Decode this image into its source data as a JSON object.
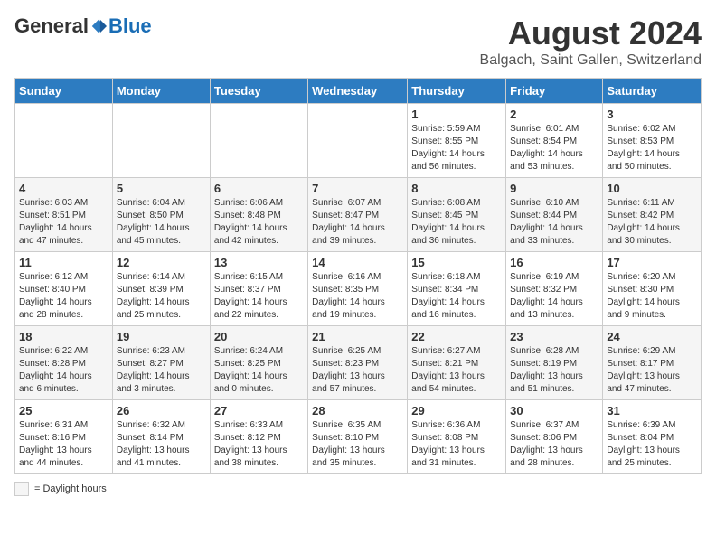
{
  "logo": {
    "general": "General",
    "blue": "Blue"
  },
  "title": "August 2024",
  "location": "Balgach, Saint Gallen, Switzerland",
  "days_of_week": [
    "Sunday",
    "Monday",
    "Tuesday",
    "Wednesday",
    "Thursday",
    "Friday",
    "Saturday"
  ],
  "weeks": [
    [
      {
        "day": "",
        "info": ""
      },
      {
        "day": "",
        "info": ""
      },
      {
        "day": "",
        "info": ""
      },
      {
        "day": "",
        "info": ""
      },
      {
        "day": "1",
        "info": "Sunrise: 5:59 AM\nSunset: 8:55 PM\nDaylight: 14 hours\nand 56 minutes."
      },
      {
        "day": "2",
        "info": "Sunrise: 6:01 AM\nSunset: 8:54 PM\nDaylight: 14 hours\nand 53 minutes."
      },
      {
        "day": "3",
        "info": "Sunrise: 6:02 AM\nSunset: 8:53 PM\nDaylight: 14 hours\nand 50 minutes."
      }
    ],
    [
      {
        "day": "4",
        "info": "Sunrise: 6:03 AM\nSunset: 8:51 PM\nDaylight: 14 hours\nand 47 minutes."
      },
      {
        "day": "5",
        "info": "Sunrise: 6:04 AM\nSunset: 8:50 PM\nDaylight: 14 hours\nand 45 minutes."
      },
      {
        "day": "6",
        "info": "Sunrise: 6:06 AM\nSunset: 8:48 PM\nDaylight: 14 hours\nand 42 minutes."
      },
      {
        "day": "7",
        "info": "Sunrise: 6:07 AM\nSunset: 8:47 PM\nDaylight: 14 hours\nand 39 minutes."
      },
      {
        "day": "8",
        "info": "Sunrise: 6:08 AM\nSunset: 8:45 PM\nDaylight: 14 hours\nand 36 minutes."
      },
      {
        "day": "9",
        "info": "Sunrise: 6:10 AM\nSunset: 8:44 PM\nDaylight: 14 hours\nand 33 minutes."
      },
      {
        "day": "10",
        "info": "Sunrise: 6:11 AM\nSunset: 8:42 PM\nDaylight: 14 hours\nand 30 minutes."
      }
    ],
    [
      {
        "day": "11",
        "info": "Sunrise: 6:12 AM\nSunset: 8:40 PM\nDaylight: 14 hours\nand 28 minutes."
      },
      {
        "day": "12",
        "info": "Sunrise: 6:14 AM\nSunset: 8:39 PM\nDaylight: 14 hours\nand 25 minutes."
      },
      {
        "day": "13",
        "info": "Sunrise: 6:15 AM\nSunset: 8:37 PM\nDaylight: 14 hours\nand 22 minutes."
      },
      {
        "day": "14",
        "info": "Sunrise: 6:16 AM\nSunset: 8:35 PM\nDaylight: 14 hours\nand 19 minutes."
      },
      {
        "day": "15",
        "info": "Sunrise: 6:18 AM\nSunset: 8:34 PM\nDaylight: 14 hours\nand 16 minutes."
      },
      {
        "day": "16",
        "info": "Sunrise: 6:19 AM\nSunset: 8:32 PM\nDaylight: 14 hours\nand 13 minutes."
      },
      {
        "day": "17",
        "info": "Sunrise: 6:20 AM\nSunset: 8:30 PM\nDaylight: 14 hours\nand 9 minutes."
      }
    ],
    [
      {
        "day": "18",
        "info": "Sunrise: 6:22 AM\nSunset: 8:28 PM\nDaylight: 14 hours\nand 6 minutes."
      },
      {
        "day": "19",
        "info": "Sunrise: 6:23 AM\nSunset: 8:27 PM\nDaylight: 14 hours\nand 3 minutes."
      },
      {
        "day": "20",
        "info": "Sunrise: 6:24 AM\nSunset: 8:25 PM\nDaylight: 14 hours\nand 0 minutes."
      },
      {
        "day": "21",
        "info": "Sunrise: 6:25 AM\nSunset: 8:23 PM\nDaylight: 13 hours\nand 57 minutes."
      },
      {
        "day": "22",
        "info": "Sunrise: 6:27 AM\nSunset: 8:21 PM\nDaylight: 13 hours\nand 54 minutes."
      },
      {
        "day": "23",
        "info": "Sunrise: 6:28 AM\nSunset: 8:19 PM\nDaylight: 13 hours\nand 51 minutes."
      },
      {
        "day": "24",
        "info": "Sunrise: 6:29 AM\nSunset: 8:17 PM\nDaylight: 13 hours\nand 47 minutes."
      }
    ],
    [
      {
        "day": "25",
        "info": "Sunrise: 6:31 AM\nSunset: 8:16 PM\nDaylight: 13 hours\nand 44 minutes."
      },
      {
        "day": "26",
        "info": "Sunrise: 6:32 AM\nSunset: 8:14 PM\nDaylight: 13 hours\nand 41 minutes."
      },
      {
        "day": "27",
        "info": "Sunrise: 6:33 AM\nSunset: 8:12 PM\nDaylight: 13 hours\nand 38 minutes."
      },
      {
        "day": "28",
        "info": "Sunrise: 6:35 AM\nSunset: 8:10 PM\nDaylight: 13 hours\nand 35 minutes."
      },
      {
        "day": "29",
        "info": "Sunrise: 6:36 AM\nSunset: 8:08 PM\nDaylight: 13 hours\nand 31 minutes."
      },
      {
        "day": "30",
        "info": "Sunrise: 6:37 AM\nSunset: 8:06 PM\nDaylight: 13 hours\nand 28 minutes."
      },
      {
        "day": "31",
        "info": "Sunrise: 6:39 AM\nSunset: 8:04 PM\nDaylight: 13 hours\nand 25 minutes."
      }
    ]
  ],
  "legend": {
    "box_label": "= Daylight hours"
  }
}
